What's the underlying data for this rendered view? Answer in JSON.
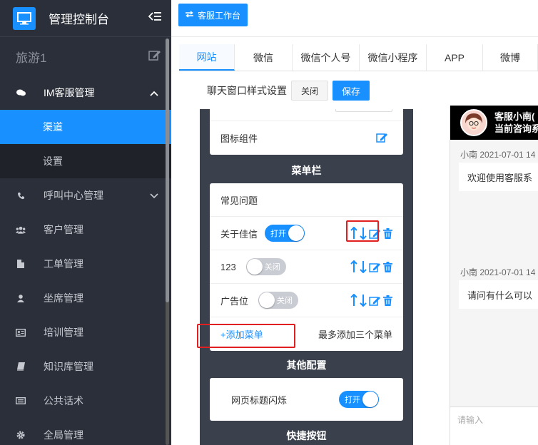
{
  "sidebar": {
    "title": "管理控制台",
    "user": "旅游1",
    "menu": [
      {
        "label": "IM客服管理",
        "icon": "chat-icon",
        "expanded": true
      },
      {
        "label": "呼叫中心管理",
        "icon": "phone-icon"
      },
      {
        "label": "客户管理",
        "icon": "users-icon"
      },
      {
        "label": "工单管理",
        "icon": "document-icon"
      },
      {
        "label": "坐席管理",
        "icon": "person-icon"
      },
      {
        "label": "培训管理",
        "icon": "id-card-icon"
      },
      {
        "label": "知识库管理",
        "icon": "book-icon"
      },
      {
        "label": "公共话术",
        "icon": "keyboard-icon"
      },
      {
        "label": "全局管理",
        "icon": "gear-icon"
      }
    ],
    "submenu": [
      {
        "label": "渠道",
        "active": true
      },
      {
        "label": "设置"
      }
    ]
  },
  "topbar": {
    "workspace_button": "客服工作台"
  },
  "tabs": [
    "网站",
    "微信",
    "微信个人号",
    "微信小程序",
    "APP",
    "微博"
  ],
  "style_settings": {
    "label": "聊天窗口样式设置",
    "close_label": "关闭",
    "save_label": "保存"
  },
  "config": {
    "icon_component_label": "图标组件",
    "menu_bar_title": "菜单栏",
    "faq_label": "常见问题",
    "menu_items": [
      {
        "label": "关于佳信",
        "toggle": "打开",
        "on": true
      },
      {
        "label": "123",
        "toggle": "关闭",
        "on": false
      },
      {
        "label": "广告位",
        "toggle": "关闭",
        "on": false
      }
    ],
    "add_menu": "+添加菜单",
    "add_hint": "最多添加三个菜单",
    "other_title": "其他配置",
    "title_flash_label": "网页标题闪烁",
    "title_flash_toggle": "打开",
    "shortcut_title": "快捷按钮"
  },
  "chat": {
    "header_name": "客服小南(",
    "header_sub": "当前咨询系",
    "messages": [
      {
        "meta": "小南 2021-07-01 14",
        "text": "欢迎使用客服系"
      },
      {
        "meta": "小南 2021-07-01 14",
        "text": "请问有什么可以"
      }
    ],
    "input_placeholder": "请输入"
  },
  "colors": {
    "accent": "#1890ff",
    "sidebar": "#2b2f3a",
    "panel": "#3a404c",
    "highlight": "#e02020"
  }
}
